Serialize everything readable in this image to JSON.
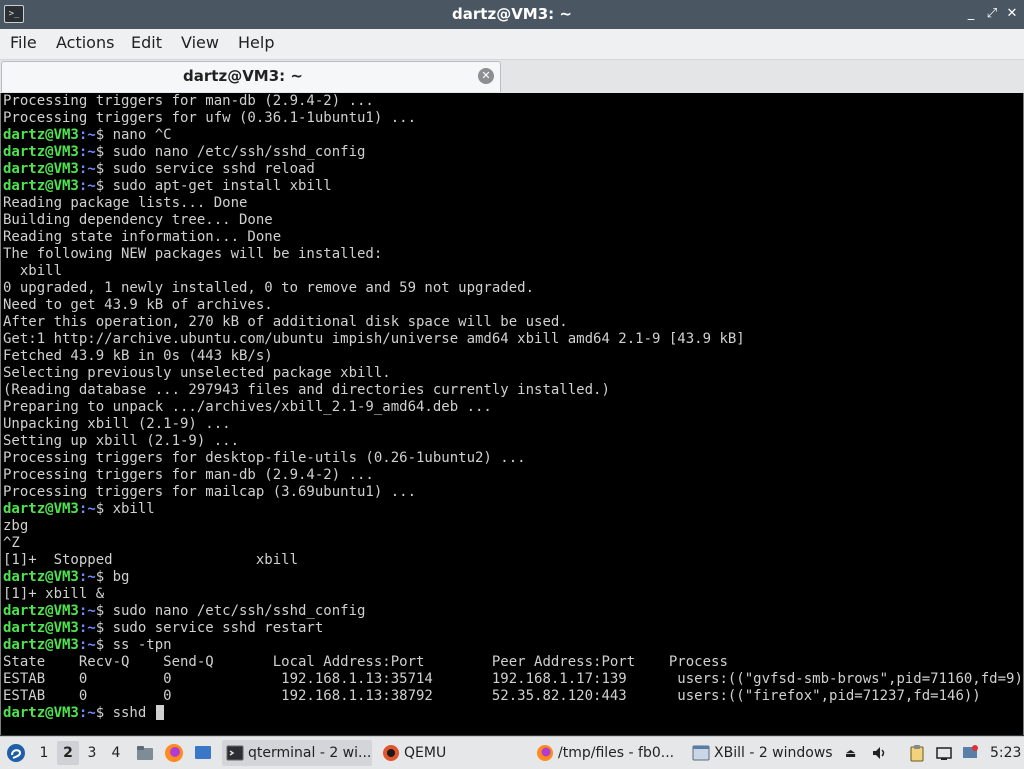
{
  "window": {
    "title": "dartz@VM3: ~"
  },
  "titlebar_buttons": {
    "minimize": "_",
    "maximize": "⤢",
    "close": "✕"
  },
  "menu": [
    "File",
    "Actions",
    "Edit",
    "View",
    "Help"
  ],
  "tab": {
    "label": "dartz@VM3: ~",
    "close": "✕"
  },
  "terminal": {
    "user_host": "dartz@VM3",
    "cwd": "~",
    "lines": [
      {
        "text": "Processing triggers for man-db (2.9.4-2) ..."
      },
      {
        "text": "Processing triggers for ufw (0.36.1-1ubuntu1) ..."
      },
      {
        "prompt": "dartz@VM3",
        "cwd": ":~",
        "cmd": "$ nano ^C"
      },
      {
        "prompt": "dartz@VM3",
        "cwd": ":~",
        "cmd": "$ sudo nano /etc/ssh/sshd_config"
      },
      {
        "prompt": "dartz@VM3",
        "cwd": ":~",
        "cmd": "$ sudo service sshd reload"
      },
      {
        "prompt": "dartz@VM3",
        "cwd": ":~",
        "cmd": "$ sudo apt-get install xbill"
      },
      {
        "text": "Reading package lists... Done"
      },
      {
        "text": "Building dependency tree... Done"
      },
      {
        "text": "Reading state information... Done"
      },
      {
        "text": "The following NEW packages will be installed:"
      },
      {
        "text": "  xbill"
      },
      {
        "text": "0 upgraded, 1 newly installed, 0 to remove and 59 not upgraded."
      },
      {
        "text": "Need to get 43.9 kB of archives."
      },
      {
        "text": "After this operation, 270 kB of additional disk space will be used."
      },
      {
        "text": "Get:1 http://archive.ubuntu.com/ubuntu impish/universe amd64 xbill amd64 2.1-9 [43.9 kB]"
      },
      {
        "text": "Fetched 43.9 kB in 0s (443 kB/s)"
      },
      {
        "text": "Selecting previously unselected package xbill."
      },
      {
        "text": "(Reading database ... 297943 files and directories currently installed.)"
      },
      {
        "text": "Preparing to unpack .../archives/xbill_2.1-9_amd64.deb ..."
      },
      {
        "text": "Unpacking xbill (2.1-9) ..."
      },
      {
        "text": "Setting up xbill (2.1-9) ..."
      },
      {
        "text": "Processing triggers for desktop-file-utils (0.26-1ubuntu2) ..."
      },
      {
        "text": "Processing triggers for man-db (2.9.4-2) ..."
      },
      {
        "text": "Processing triggers for mailcap (3.69ubuntu1) ..."
      },
      {
        "prompt": "dartz@VM3",
        "cwd": ":~",
        "cmd": "$ xbill"
      },
      {
        "text": "zbg"
      },
      {
        "text": "^Z"
      },
      {
        "text": "[1]+  Stopped                 xbill"
      },
      {
        "prompt": "dartz@VM3",
        "cwd": ":~",
        "cmd": "$ bg"
      },
      {
        "text": "[1]+ xbill &"
      },
      {
        "prompt": "dartz@VM3",
        "cwd": ":~",
        "cmd": "$ sudo nano /etc/ssh/sshd_config"
      },
      {
        "prompt": "dartz@VM3",
        "cwd": ":~",
        "cmd": "$ sudo service sshd restart"
      },
      {
        "prompt": "dartz@VM3",
        "cwd": ":~",
        "cmd": "$ ss -tpn"
      },
      {
        "text": "State    Recv-Q    Send-Q       Local Address:Port        Peer Address:Port    Process"
      },
      {
        "text": "ESTAB    0         0             192.168.1.13:35714       192.168.1.17:139      users:((\"gvfsd-smb-brows\",pid=71160,fd=9))"
      },
      {
        "text": "ESTAB    0         0             192.168.1.13:38792       52.35.82.120:443      users:((\"firefox\",pid=71237,fd=146))"
      },
      {
        "prompt": "dartz@VM3",
        "cwd": ":~",
        "cmd": "$ sshd ",
        "cursor": true
      }
    ]
  },
  "taskbar": {
    "workspaces": [
      "1",
      "2",
      "3",
      "4"
    ],
    "active_workspace": "2",
    "tasks": [
      {
        "label": "qterminal - 2 wi...",
        "icon": "terminal-icon",
        "active": true
      },
      {
        "label": "QEMU",
        "icon": "qemu-icon",
        "active": false
      },
      {
        "label": "/tmp/files - fb0...",
        "icon": "firefox-icon",
        "active": false
      },
      {
        "label": "XBill - 2 windows",
        "icon": "xbill-icon",
        "active": false
      }
    ],
    "clock": "5:23"
  },
  "colors": {
    "titlebar": "#4a5763",
    "terminal_bg": "#000000",
    "prompt_green": "#4ee44e",
    "cwd_blue": "#6f8fff"
  }
}
